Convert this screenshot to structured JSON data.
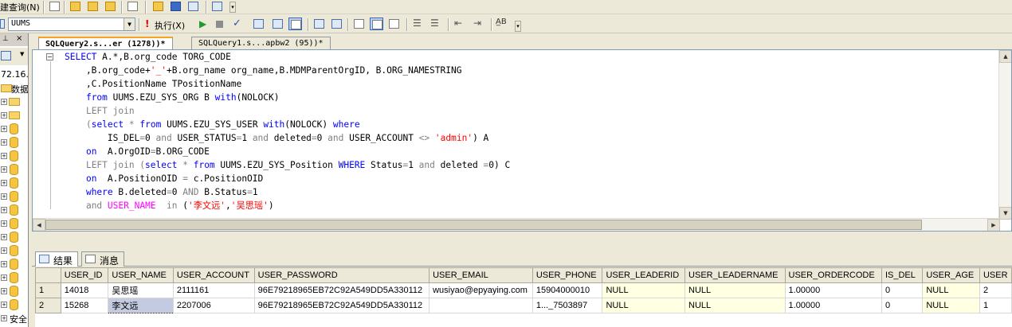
{
  "toolbar1": {
    "label": "建查询(N)"
  },
  "toolbar2": {
    "database": "UUMS",
    "execute_label": "执行(X)"
  },
  "object_explorer": {
    "server": "72.16.",
    "databases_label": "数据",
    "security_label": "安全"
  },
  "tabs": {
    "active": "SQLQuery2.s...er (1278))*",
    "inactive": "SQLQuery1.s...apbw2 (95))*"
  },
  "editor": {
    "lines": [
      "SELECT A.*,B.org_code TORG_CODE",
      "    ,B.org_code+'_'+B.org_name org_name,B.MDMParentOrgID, B.ORG_NAMESTRING",
      "    ,C.PositionName TPositionName",
      "    from UUMS.EZU_SYS_ORG B with(NOLOCK)",
      "    LEFT join",
      "    (select * from UUMS.EZU_SYS_USER with(NOLOCK) where",
      "        IS_DEL=0 and USER_STATUS=1 and deleted=0 and USER_ACCOUNT <> 'admin') A",
      "    on  A.OrgOID=B.ORG_CODE",
      "    LEFT join (select * from UUMS.EZU_SYS_Position WHERE Status=1 and deleted =0) C",
      "    on  A.PositionOID = c.PositionOID",
      "    where B.deleted=0 AND B.Status=1",
      "    and USER_NAME  in ('李文远','吴思瑶')"
    ]
  },
  "results_tabs": {
    "results": "结果",
    "messages": "消息"
  },
  "grid": {
    "columns": [
      "USER_ID",
      "USER_NAME",
      "USER_ACCOUNT",
      "USER_PASSWORD",
      "USER_EMAIL",
      "USER_PHONE",
      "USER_LEADERID",
      "USER_LEADERNAME",
      "USER_ORDERCODE",
      "IS_DEL",
      "USER_AGE",
      "USER"
    ],
    "rows": [
      {
        "num": "1",
        "cells": [
          "14018",
          "吴思瑶",
          "2111161",
          "96E79218965EB72C92A549DD5A330112",
          "wusiyao@epyaying.com",
          "15904000010",
          "NULL",
          "NULL",
          "1.00000",
          "0",
          "NULL",
          "2"
        ]
      },
      {
        "num": "2",
        "cells": [
          "15268",
          "李文远",
          "2207006",
          "96E79218965EB72C92A549DD5A330112",
          "",
          "1..._7503897",
          "NULL",
          "NULL",
          "1.00000",
          "0",
          "NULL",
          "1"
        ]
      }
    ]
  }
}
